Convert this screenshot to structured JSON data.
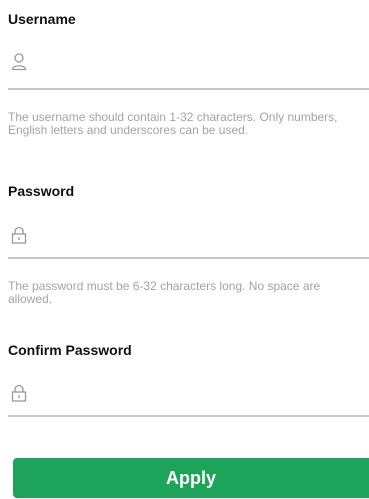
{
  "username": {
    "label": "Username",
    "value": "",
    "placeholder": "",
    "icon": "user-icon",
    "hint": "The username should contain 1-32 characters. Only numbers, English letters and underscores can be used."
  },
  "password": {
    "label": "Password",
    "value": "",
    "placeholder": "",
    "icon": "lock-icon",
    "hint": "The password must be 6-32 characters long. No space are allowed."
  },
  "confirm_password": {
    "label": "Confirm Password",
    "value": "",
    "placeholder": "",
    "icon": "lock-icon"
  },
  "apply_button": {
    "label": "Apply"
  },
  "colors": {
    "accent": "#1ea35a",
    "hint_text": "#a3a3a3",
    "underline": "#c8c8c8"
  }
}
